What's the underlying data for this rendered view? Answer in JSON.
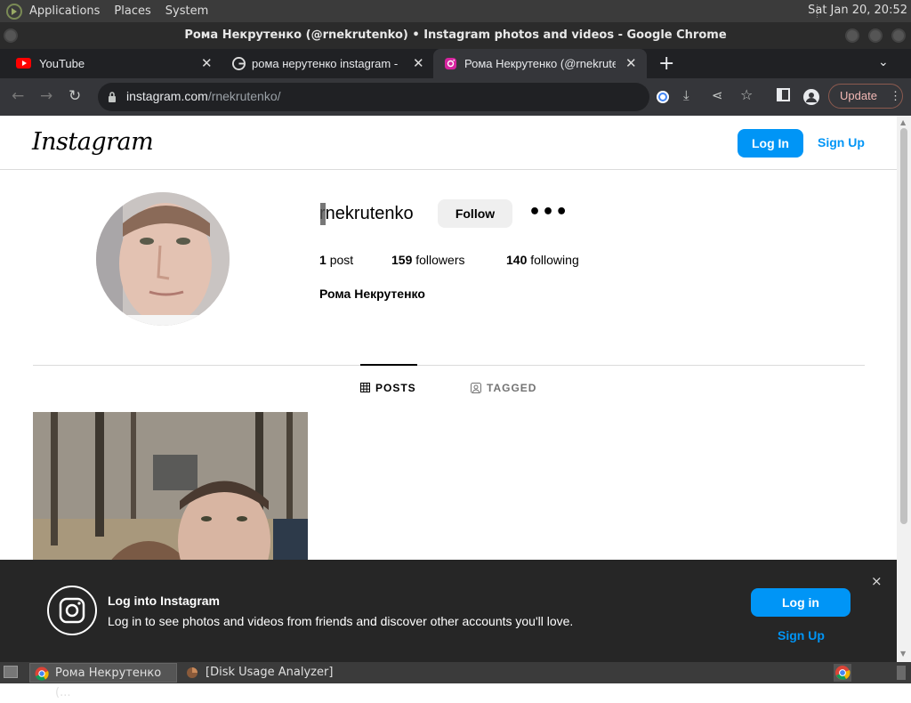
{
  "panel": {
    "menus": [
      "Applications",
      "Places",
      "System"
    ],
    "clock": "Sat Jan 20, 20:52"
  },
  "window": {
    "title": "Рома Некрутенко (@rnekrutenko) • Instagram photos and videos - Google Chrome"
  },
  "tabs": [
    {
      "title": "YouTube",
      "favicon": "youtube-icon"
    },
    {
      "title": "рома нерутенко instagram - Г",
      "favicon": "google-icon"
    },
    {
      "title": "Рома Некрутенко (@rnekrute",
      "favicon": "instagram-icon"
    }
  ],
  "browser": {
    "url_host": "instagram.com",
    "url_path": "/rnekrutenko/",
    "update_label": "Update"
  },
  "header": {
    "logo": "Instagram",
    "login": "Log In",
    "signup": "Sign Up"
  },
  "profile": {
    "username": "rnekrutenko",
    "follow": "Follow",
    "more": "•••",
    "posts_count": "1",
    "posts_label": "post",
    "followers_count": "159",
    "followers_label": "followers",
    "following_count": "140",
    "following_label": "following",
    "full_name": "Рома Некрутенко"
  },
  "profile_tabs": [
    "POSTS",
    "TAGGED"
  ],
  "banner": {
    "title": "Log into Instagram",
    "subtitle": "Log in to see photos and videos from friends and discover other accounts you'll love.",
    "login": "Log in",
    "signup": "Sign Up",
    "close": "×"
  },
  "taskbar": {
    "items": [
      "Рома Некрутенко (...",
      "[Disk Usage Analyzer]"
    ]
  },
  "colors": {
    "accent": "#0095f6",
    "chrome_dark": "#202124",
    "chrome_toolbar": "#35363a",
    "banner": "#262626"
  }
}
